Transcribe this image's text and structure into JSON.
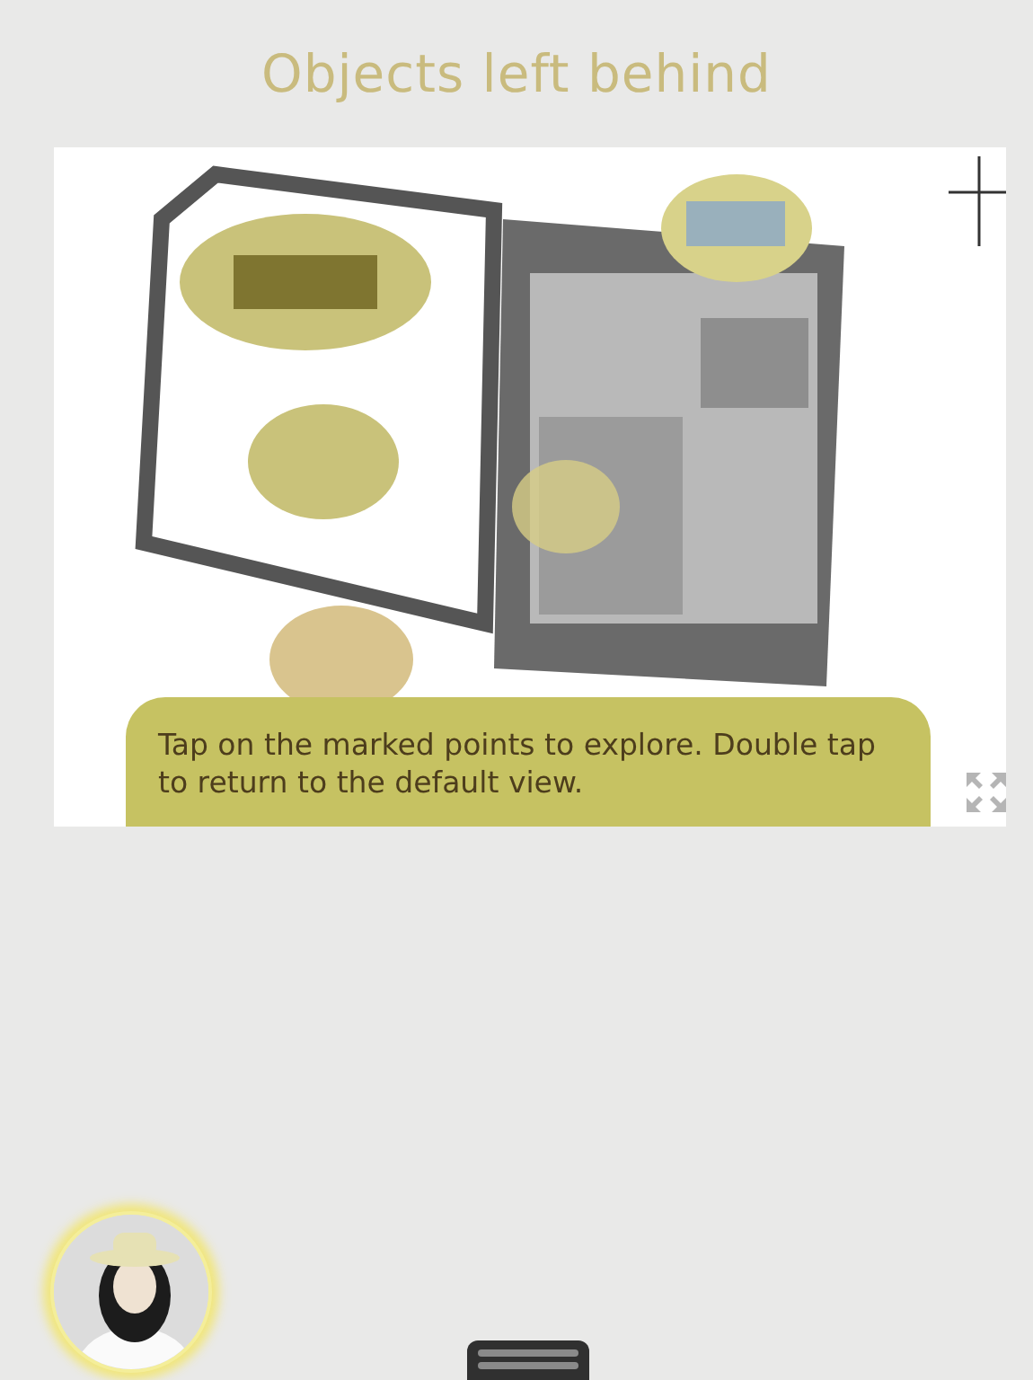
{
  "title": "Objects left behind",
  "hint": "Tap on the marked points to explore. Double tap to return to the default view."
}
